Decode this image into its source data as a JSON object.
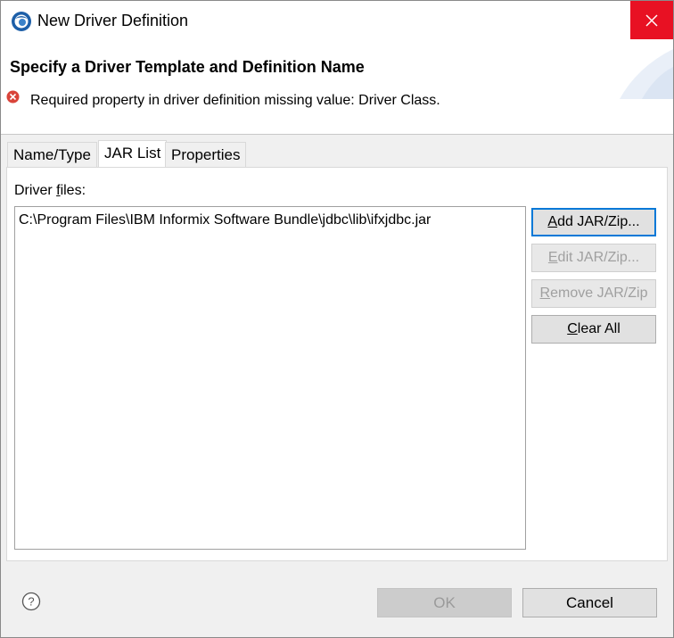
{
  "window": {
    "title": "New Driver Definition"
  },
  "header": {
    "title": "Specify a Driver Template and Definition Name",
    "error_message": "Required property in driver definition missing value: Driver Class."
  },
  "tabs": [
    {
      "label": "Name/Type",
      "active": false
    },
    {
      "label": "JAR List",
      "active": true
    },
    {
      "label": "Properties",
      "active": false
    }
  ],
  "jar_list": {
    "label_prefix": "Driver ",
    "label_mnemonic": "f",
    "label_suffix": "iles:",
    "files": [
      "C:\\Program Files\\IBM Informix Software Bundle\\jdbc\\lib\\ifxjdbc.jar"
    ],
    "buttons": {
      "add": {
        "mnemonic": "A",
        "rest": "dd JAR/Zip...",
        "enabled": true
      },
      "edit": {
        "mnemonic": "E",
        "rest": "dit JAR/Zip...",
        "enabled": false
      },
      "remove": {
        "mnemonic": "R",
        "rest": "emove JAR/Zip",
        "enabled": false
      },
      "clear": {
        "mnemonic": "C",
        "rest": "lear All",
        "enabled": true
      }
    }
  },
  "footer": {
    "ok_label": "OK",
    "cancel_label": "Cancel"
  },
  "colors": {
    "close_button": "#e81123",
    "error_icon": "#d9443a",
    "default_button_border": "#0078d7"
  },
  "icons": [
    "app-eclipse-icon",
    "close-icon",
    "error-icon",
    "help-icon"
  ]
}
